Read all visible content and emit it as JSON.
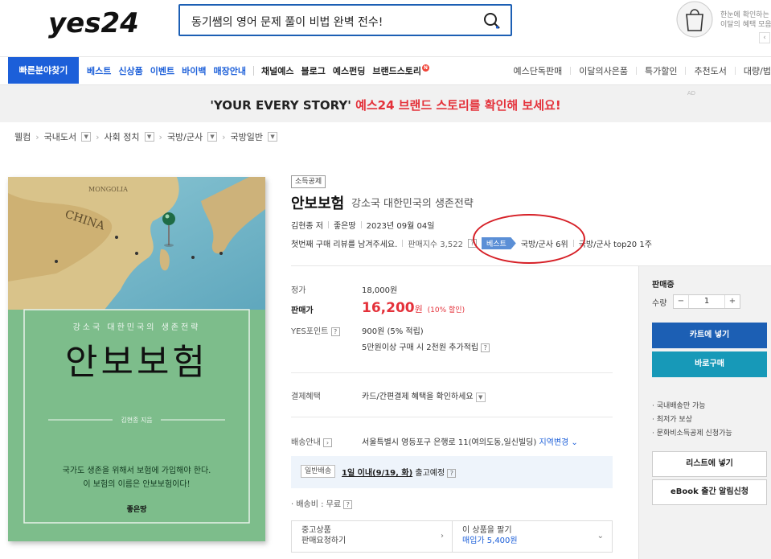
{
  "header": {
    "logo_text": "yes24",
    "search_query": "동기쌤의 영어 문제 풀이 비법 완벽 전수!",
    "bag_text_line1": "한눈에 확인하는",
    "bag_text_line2": "이달의 혜택 모음",
    "bag_arrow": "‹"
  },
  "nav": {
    "quick_find": "빠른분야찾기",
    "left_blue": [
      "베스트",
      "신상품",
      "이벤트",
      "바이백",
      "매장안내"
    ],
    "left_black": [
      "채널예스",
      "블로그",
      "예스펀딩",
      "브랜드스토리"
    ],
    "brand_badge": "N",
    "right": [
      "예스단독판매",
      "이달의사은품",
      "특가할인",
      "추천도서",
      "대량/법"
    ]
  },
  "banner": {
    "quote": "'YOUR EVERY STORY'",
    "text": " 예스24 브랜드 스토리를 확인해 보세요!",
    "ad_label": "AD"
  },
  "breadcrumb": {
    "home": "웰컴",
    "items": [
      "국내도서",
      "사회 정치",
      "국방/군사",
      "국방일반"
    ]
  },
  "cover": {
    "map_label": "CHINA",
    "map_label_mongolia": "MONGOLIA",
    "subtitle": "강소국 대한민국의 생존전략",
    "title": "안보보험",
    "author": "김현종 지음",
    "blurb_line1": "국가도 생존을 위해서 보험에 가입해야 한다.",
    "blurb_line2": "이 보험의 이름은 안보보험이다!",
    "publisher": "좋은땅"
  },
  "product": {
    "tag": "소득공제",
    "title": "안보보험",
    "subtitle": "강소국 대한민국의 생존전략",
    "author": "김현종 저",
    "publisher": "좋은땅",
    "date": "2023년 09월 04일",
    "review_prompt": "첫번째 구매 리뷰를 남겨주세요.",
    "sales_index": "판매지수 3,522",
    "best_badge": "베스트",
    "rank1": "국방/군사 6위",
    "rank2": "국방/군사 top20 1주"
  },
  "price": {
    "list_label": "정가",
    "list_value": "18,000원",
    "sale_label": "판매가",
    "sale_value": "16,200",
    "sale_unit": "원",
    "discount": "(10% 할인)",
    "points_label": "YES포인트",
    "points_value": "900원 (5% 적립)",
    "points_extra": "5만원이상 구매 시 2천원 추가적립",
    "q": "?"
  },
  "payment": {
    "label": "결제혜택",
    "value": "카드/간편결제 혜택을 확인하세요"
  },
  "delivery": {
    "label": "배송안내",
    "address": "서울특별시 영등포구 은행로 11(여의도동,일신빌딩)",
    "change": "지역변경",
    "type": "일반배송",
    "when": "1일 이내(9/19, 화)",
    "when_suffix": " 출고예정",
    "fee": "· 배송비 : 무료"
  },
  "used": {
    "left_line1": "중고상품",
    "left_line2": "판매요청하기",
    "right_line1": "이 상품을 팔기",
    "right_line2": "매입가 5,400원"
  },
  "panel": {
    "heading": "판매중",
    "qty_label": "수량",
    "minus": "−",
    "qty": "1",
    "plus": "+",
    "cart": "카트에 넣기",
    "buy": "바로구매",
    "notes": [
      "· 국내배송만 가능",
      "· 최저가 보상",
      "· 문화비소득공제 신청가능"
    ],
    "wish": "리스트에 넣기",
    "ebook": "eBook 출간 알림신청"
  },
  "colors": {
    "brand_blue": "#1c5fd9",
    "sale_red": "#e4313a",
    "cover_green": "#7dbd8b",
    "highlight_circle": "#d61f26"
  }
}
